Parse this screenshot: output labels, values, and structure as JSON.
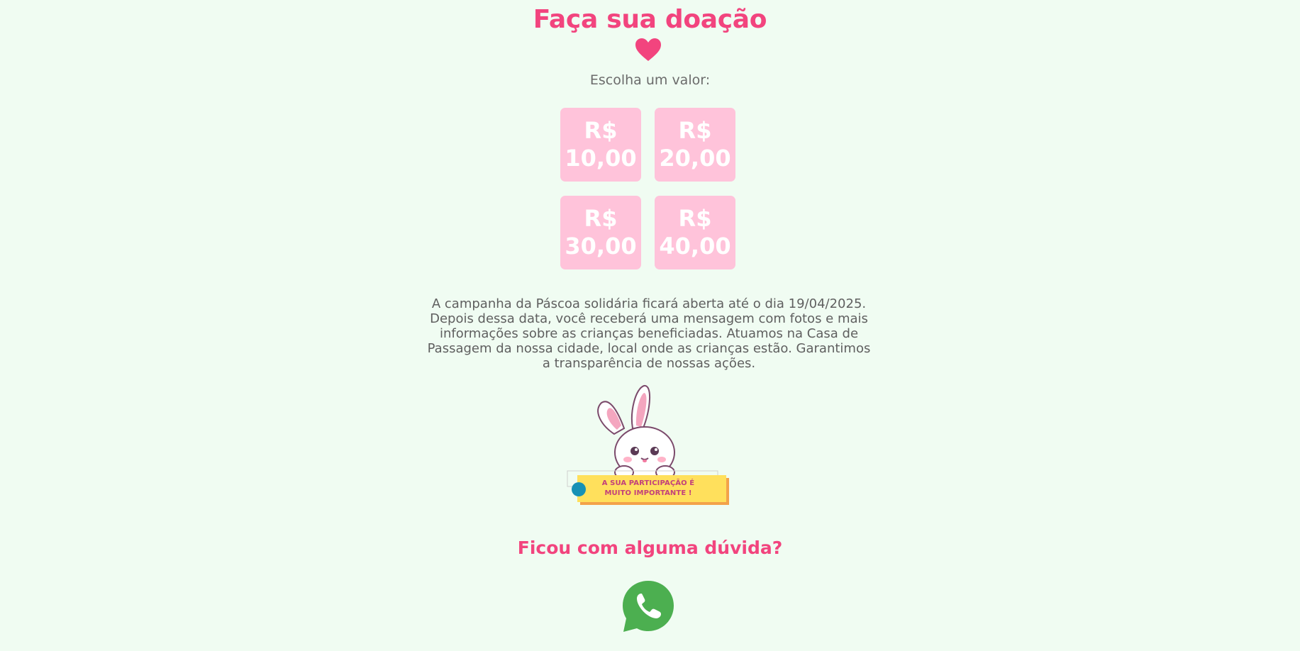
{
  "header": {
    "title": "Faça sua doação",
    "subtitle": "Escolha um valor:"
  },
  "amounts": [
    {
      "currency": "R$",
      "value": "10,00"
    },
    {
      "currency": "R$",
      "value": "20,00"
    },
    {
      "currency": "R$",
      "value": "30,00"
    },
    {
      "currency": "R$",
      "value": "40,00"
    }
  ],
  "info": {
    "text": "A campanha da Páscoa solidária ficará aberta até o dia 19/04/2025. Depois dessa data, você receberá uma mensagem com fotos e mais informações sobre as crianças beneficiadas. Atuamos na Casa de Passagem da nossa cidade, local onde as crianças estão. Garantimos a transparência de nossas ações."
  },
  "bunny_banner": {
    "line1": "A SUA PARTICIPAÇÃO É",
    "line2": "MUITO IMPORTANTE !"
  },
  "contact": {
    "question": "Ficou com alguma dúvida?",
    "icon": "whatsapp-icon"
  },
  "colors": {
    "background": "#f0fcf2",
    "accent": "#f2447e",
    "amount_button": "#ffc3da",
    "whatsapp": "#4caf50"
  }
}
